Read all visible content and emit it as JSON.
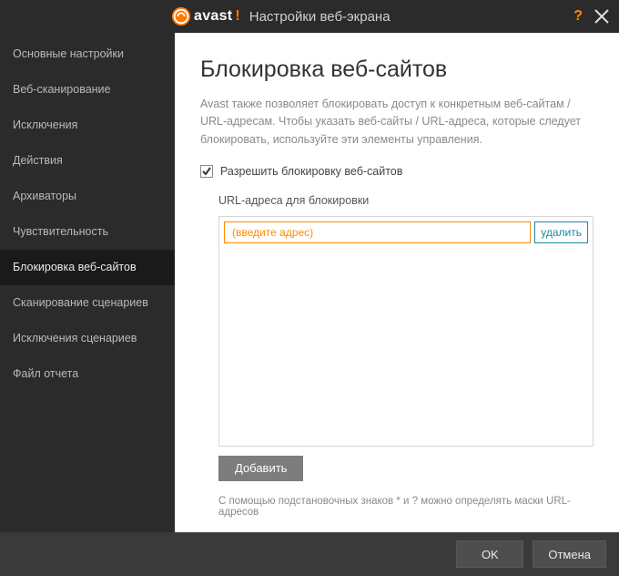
{
  "titlebar": {
    "brand": "avast",
    "brand_exclaim": "!",
    "title": "Настройки веб-экрана",
    "help": "?",
    "close": "✕"
  },
  "sidebar": {
    "items": [
      {
        "label": "Основные настройки"
      },
      {
        "label": "Веб-сканирование"
      },
      {
        "label": "Исключения"
      },
      {
        "label": "Действия"
      },
      {
        "label": "Архиваторы"
      },
      {
        "label": "Чувствительность"
      },
      {
        "label": "Блокировка веб-сайтов"
      },
      {
        "label": "Сканирование сценариев"
      },
      {
        "label": "Исключения сценариев"
      },
      {
        "label": "Файл отчета"
      }
    ],
    "active_index": 6
  },
  "main": {
    "heading": "Блокировка веб-сайтов",
    "description": "Avast также позволяет блокировать доступ к конкретным веб-сайтам / URL-адресам. Чтобы указать веб-сайты / URL-адреса, которые следует блокировать, используйте эти элементы управления.",
    "enable_label": "Разрешить блокировку веб-сайтов",
    "url_list_label": "URL-адреса для блокировки",
    "url_placeholder": "(введите адрес)",
    "delete_label": "удалить",
    "add_label": "Добавить",
    "note": "С помощью подстановочных знаков * и ? можно определять маски URL-адресов"
  },
  "footer": {
    "ok": "OK",
    "cancel": "Отмена"
  }
}
